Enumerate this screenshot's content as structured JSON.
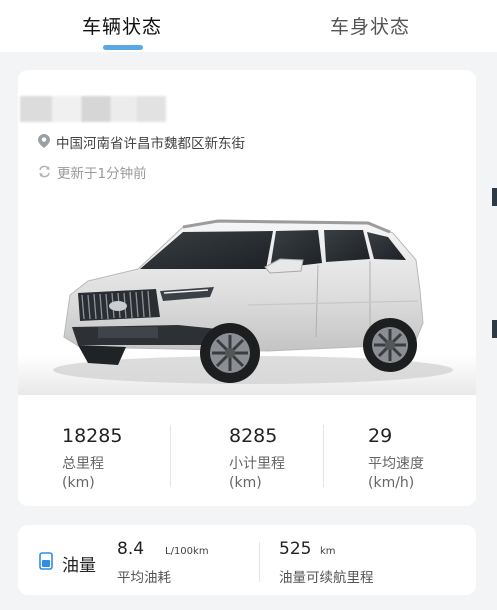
{
  "tabs": [
    {
      "label": "车辆状态",
      "active": true
    },
    {
      "label": "车身状态",
      "active": false
    }
  ],
  "colors": {
    "accent": "#5aa7e6",
    "fuel_icon": "#2f8de4"
  },
  "vehicle": {
    "location": "中国河南省许昌市魏都区新东街",
    "updated": "更新于1分钟前"
  },
  "stats": [
    {
      "value": "18285",
      "label": "总里程",
      "unit": "(km)"
    },
    {
      "value": "8285",
      "label": "小计里程",
      "unit": "(km)"
    },
    {
      "value": "29",
      "label": "平均速度",
      "unit": "(km/h)"
    }
  ],
  "fuel": {
    "title": "油量",
    "avg_value": "8.4",
    "avg_unit": "L/100km",
    "avg_label": "平均油耗",
    "range_value": "525",
    "range_unit": "km",
    "range_label": "油量可续航里程"
  }
}
